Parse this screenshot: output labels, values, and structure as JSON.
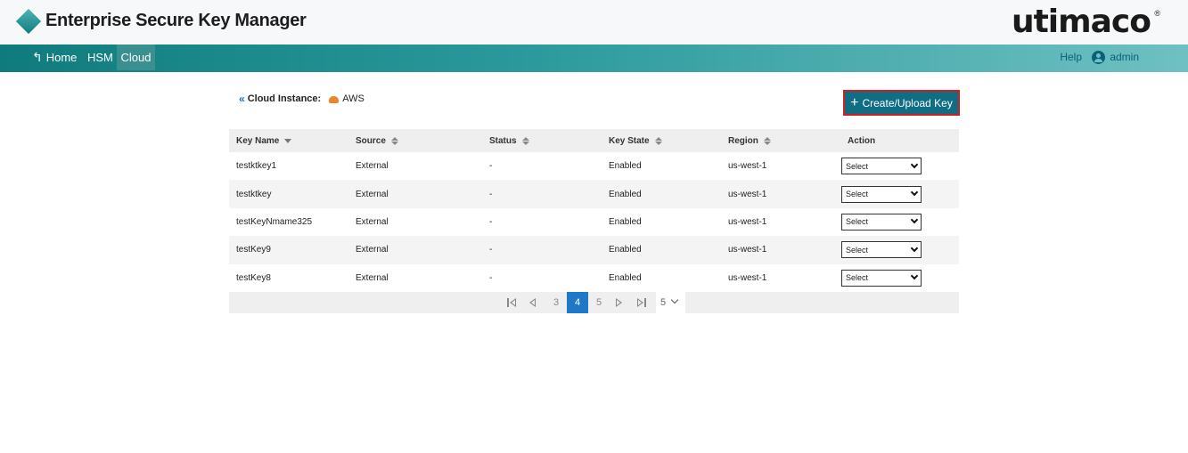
{
  "header": {
    "app_title": "Enterprise Secure Key Manager",
    "brand": "utimaco",
    "brand_mark": "®"
  },
  "nav": {
    "home": "Home",
    "hsm": "HSM",
    "cloud": "Cloud",
    "help": "Help",
    "user": "admin"
  },
  "breadcrumb": {
    "back": "«",
    "label": "Cloud Instance:",
    "value": "AWS"
  },
  "actions": {
    "create_label": "Create/Upload Key",
    "create_plus": "+"
  },
  "table": {
    "headers": [
      "Key Name",
      "Source",
      "Status",
      "Key State",
      "Region",
      "Action"
    ],
    "rows": [
      {
        "name": "testktkey1",
        "source": "External",
        "status": "-",
        "state": "Enabled",
        "region": "us-west-1",
        "action": "Select"
      },
      {
        "name": "testktkey",
        "source": "External",
        "status": "-",
        "state": "Enabled",
        "region": "us-west-1",
        "action": "Select"
      },
      {
        "name": "testKeyNmame325",
        "source": "External",
        "status": "-",
        "state": "Enabled",
        "region": "us-west-1",
        "action": "Select"
      },
      {
        "name": "testKey9",
        "source": "External",
        "status": "-",
        "state": "Enabled",
        "region": "us-west-1",
        "action": "Select"
      },
      {
        "name": "testKey8",
        "source": "External",
        "status": "-",
        "state": "Enabled",
        "region": "us-west-1",
        "action": "Select"
      }
    ]
  },
  "pager": {
    "pages": [
      "3",
      "4",
      "5"
    ],
    "current": "4",
    "page_size": "5"
  },
  "colors": {
    "nav_start": "#0f7b7d",
    "nav_end": "#6fc0c2",
    "primary_button": "#0f6e84",
    "highlight_border": "#d11f1f",
    "active_page": "#1f78c7"
  }
}
